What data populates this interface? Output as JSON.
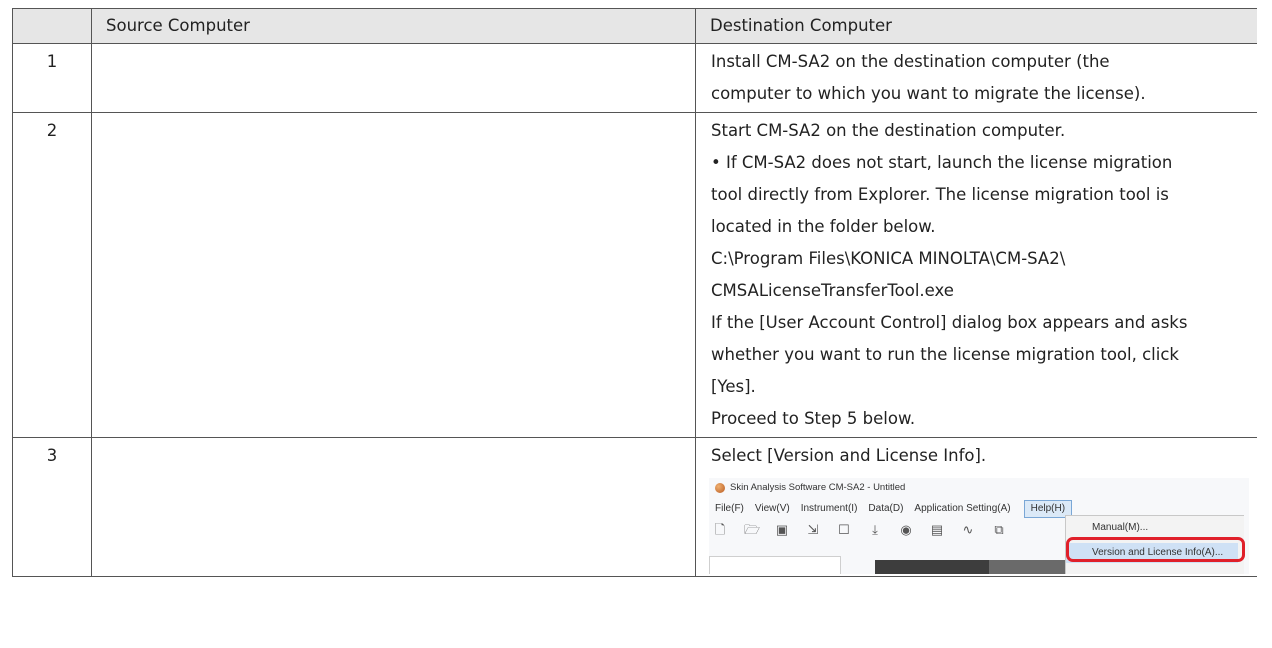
{
  "table": {
    "header": {
      "num": "",
      "source": "Source Computer",
      "destination": "Destination Computer"
    },
    "rows": [
      {
        "num": "1",
        "source": "",
        "destination_lines": [
          "Install CM-SA2 on the destination computer (the",
          "computer to which you want to migrate the license)."
        ]
      },
      {
        "num": "2",
        "source": "",
        "destination_lines": [
          "Start CM-SA2 on the destination computer.",
          "• If CM-SA2 does not start, launch the license migration",
          "tool directly from Explorer. The license migration tool is",
          "located in the folder below.",
          "C:\\Program Files\\KONICA MINOLTA\\CM-SA2\\",
          "CMSALicenseTransferTool.exe",
          "If the [User Account Control] dialog box appears and asks",
          "whether you want to run the license migration tool, click",
          "[Yes].",
          "Proceed to Step 5 below."
        ]
      },
      {
        "num": "3",
        "source": "",
        "destination_lines": [
          "Select [Version and License Info]."
        ]
      }
    ]
  },
  "screenshot": {
    "title": "Skin Analysis Software CM-SA2 - Untitled",
    "menu": [
      "File(F)",
      "View(V)",
      "Instrument(I)",
      "Data(D)",
      "Application Setting(A)",
      "Help(H)"
    ],
    "help_menu_items": [
      "Manual(M)...",
      "Version and License Info(A)..."
    ],
    "highlight_color": "#e0202a"
  }
}
